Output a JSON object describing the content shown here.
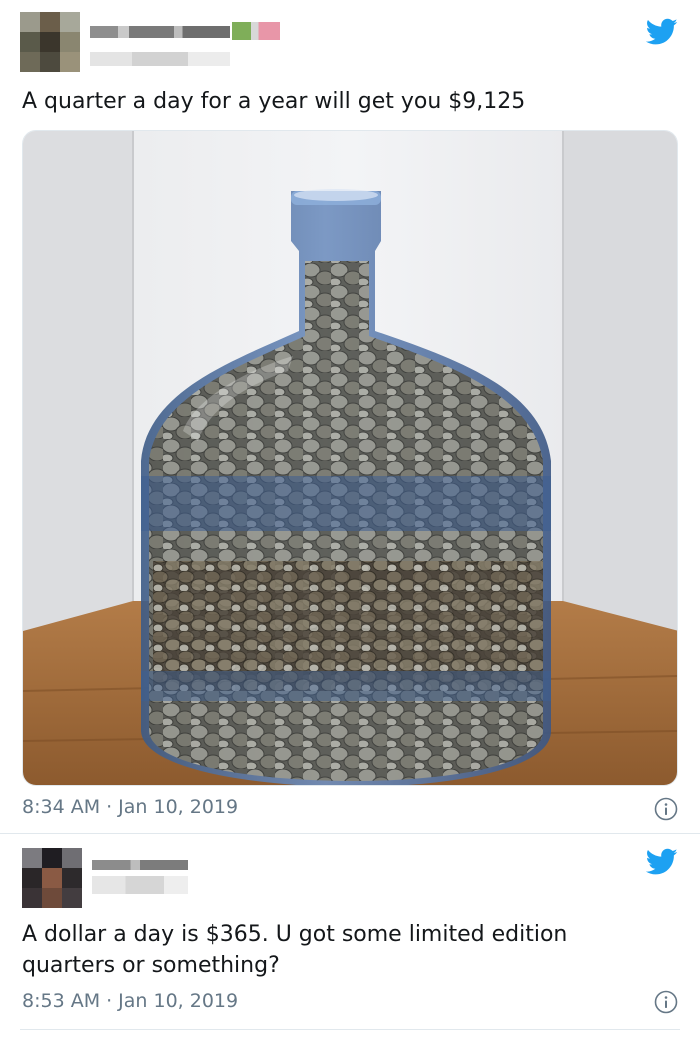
{
  "tweets": [
    {
      "text": "A quarter a day for a year will get you $9,125",
      "time": "8:34 AM",
      "date": "Jan 10, 2019",
      "has_photo": true,
      "photo_description_icon": "coin-jug-photo"
    },
    {
      "text": "A dollar a day is $365. U got some limited edition quarters or something?",
      "time": "8:53 AM",
      "date": "Jan 10, 2019",
      "has_photo": false
    }
  ],
  "separator": "·",
  "colors": {
    "twitter_blue": "#1da1f2",
    "meta_gray": "#657786",
    "text": "#14171a",
    "divider": "#e1e8ed"
  },
  "icons": {
    "brand": "twitter-bird-icon",
    "info": "info-icon"
  }
}
